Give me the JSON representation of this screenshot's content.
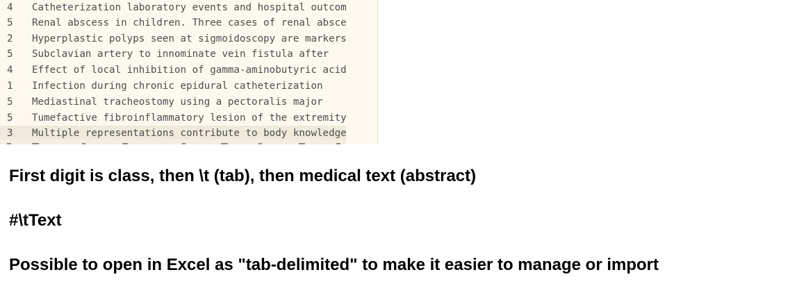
{
  "editor": {
    "lines": [
      {
        "class": "4",
        "text": "Catheterization laboratory events and hospital outcome"
      },
      {
        "class": "5",
        "text": "Renal abscess in children. Three cases of renal abscesses"
      },
      {
        "class": "2",
        "text": "Hyperplastic polyps seen at sigmoidoscopy are markers"
      },
      {
        "class": "5",
        "text": "Subclavian artery to innominate vein fistula after"
      },
      {
        "class": "4",
        "text": "Effect of local inhibition of gamma-aminobutyric acid"
      },
      {
        "class": "1",
        "text": "Infection during chronic epidural catheterization"
      },
      {
        "class": "5",
        "text": "Mediastinal tracheostomy using a pectoralis major"
      },
      {
        "class": "5",
        "text": "Tumefactive fibroinflammatory lesion of the extremity"
      },
      {
        "class": "3",
        "text": "Multiple representations contribute to body knowledge"
      }
    ],
    "highlighted_line": 8
  },
  "notes": [
    "First digit is class, then \\t (tab), then medical text (abstract)",
    "#\\tText",
    "Possible to open in Excel as \"tab-delimited\" to make it easier to manage or import"
  ]
}
